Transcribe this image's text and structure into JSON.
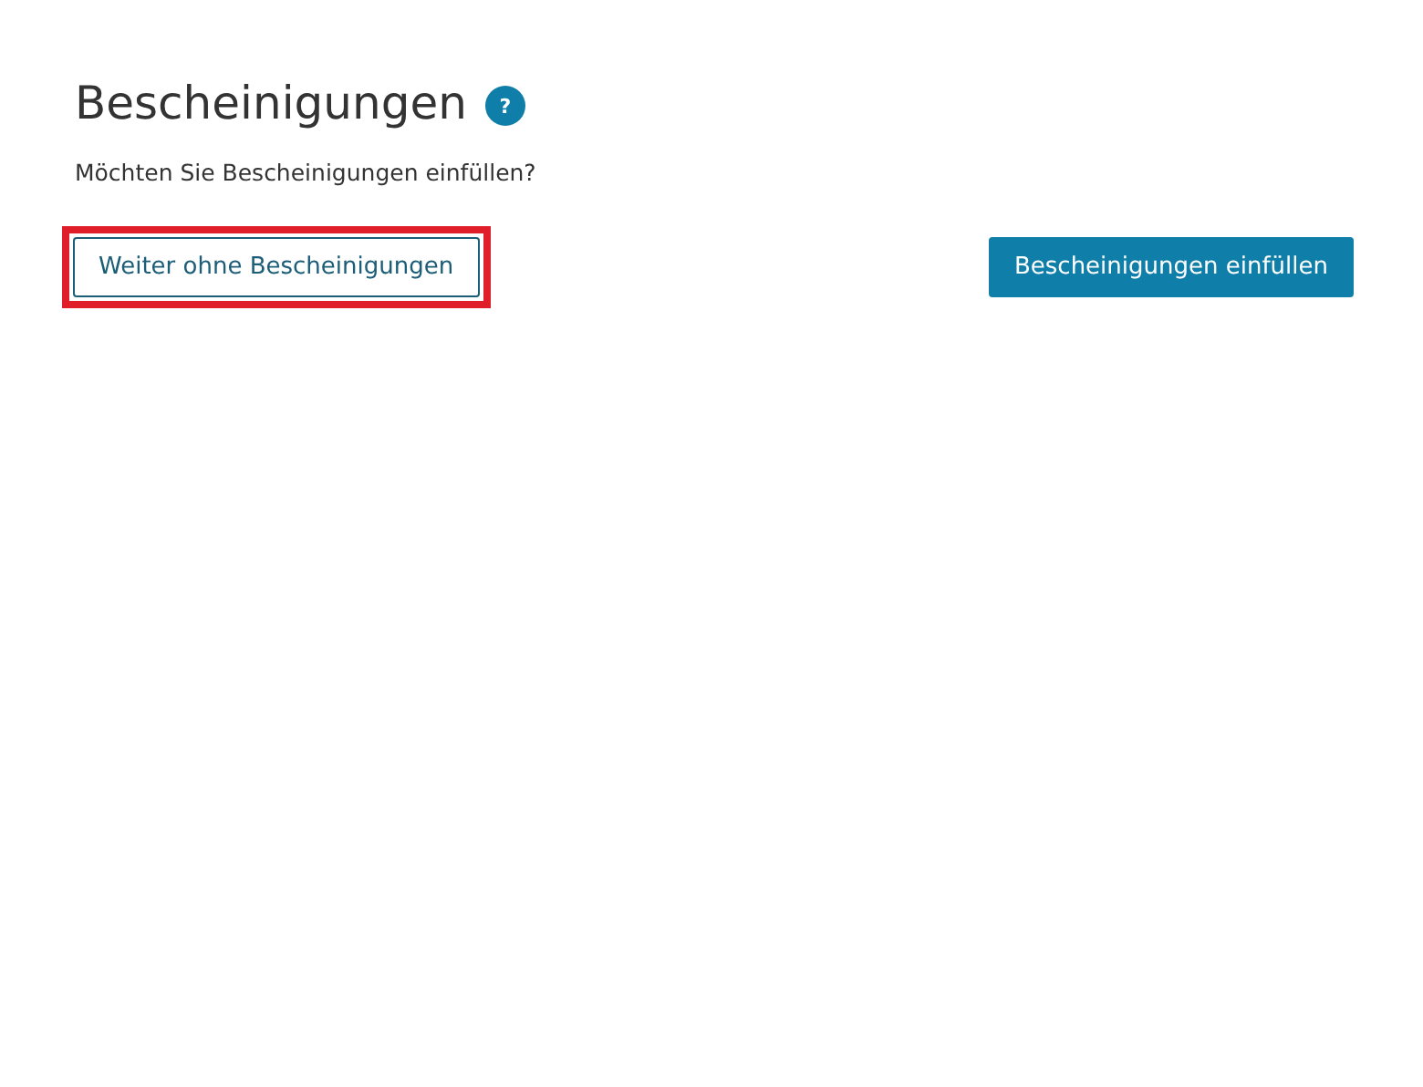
{
  "title": "Bescheinigungen",
  "help_icon": "?",
  "question": "Möchten Sie Bescheinigungen einfüllen?",
  "buttons": [
    {
      "label": "Weiter ohne Bescheinigungen",
      "kind": "secondary",
      "highlighted": true
    },
    {
      "label": "Bescheinigungen einfüllen",
      "kind": "primary",
      "highlighted": false
    }
  ]
}
